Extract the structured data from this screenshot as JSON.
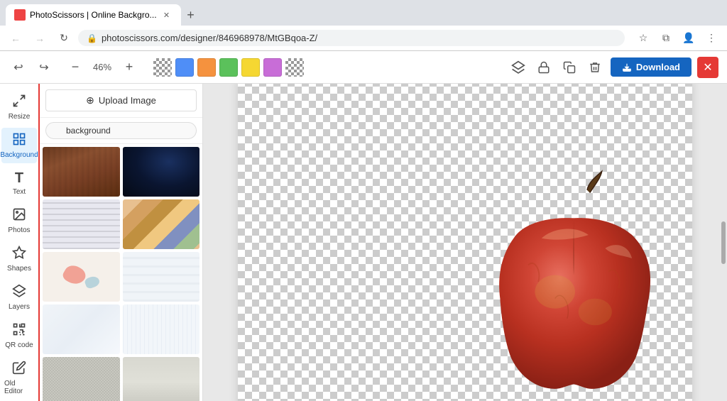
{
  "browser": {
    "tab_title": "PhotoScissors | Online Backgro...",
    "tab_favicon": "🖼",
    "url": "photoscissors.com/designer/846968978/MtGBqoa-Z/",
    "url_protocol": "🔒",
    "new_tab_label": "+",
    "nav": {
      "back": "←",
      "forward": "→",
      "reload": "↻",
      "secure": "⊙"
    }
  },
  "toolbar": {
    "undo": "↩",
    "redo": "↪",
    "zoom_out": "−",
    "zoom_level": "46%",
    "zoom_in": "+",
    "download_label": "Download",
    "close_label": "✕",
    "colors": [
      "#4f8ef7",
      "#f5923e",
      "#5bc15b",
      "#f5d732",
      "#c86dd7"
    ],
    "icons": {
      "layers": "⊞",
      "lock": "🔒",
      "duplicate": "⧉",
      "trash": "🗑"
    }
  },
  "sidebar": {
    "items": [
      {
        "id": "resize",
        "label": "Resize",
        "icon": "⤢"
      },
      {
        "id": "background",
        "label": "Background",
        "icon": "⊞",
        "active": true
      },
      {
        "id": "text",
        "label": "Text",
        "icon": "T"
      },
      {
        "id": "photos",
        "label": "Photos",
        "icon": "🖼"
      },
      {
        "id": "shapes",
        "label": "Shapes",
        "icon": "◈"
      },
      {
        "id": "layers",
        "label": "Layers",
        "icon": "⊛"
      },
      {
        "id": "qrcode",
        "label": "QR code",
        "icon": "⊞"
      },
      {
        "id": "old-editor",
        "label": "Old Editor",
        "icon": "✎"
      }
    ]
  },
  "panel": {
    "upload_label": "Upload Image",
    "search_placeholder": "background",
    "images": [
      {
        "id": 1,
        "color": "#7a4a2a",
        "type": "wood"
      },
      {
        "id": 2,
        "color": "#1a2a4a",
        "type": "dark-space"
      },
      {
        "id": 3,
        "color": "#c8c8d0",
        "type": "light-stripes"
      },
      {
        "id": 4,
        "color": "#d4956a",
        "type": "colorful-stripes"
      },
      {
        "id": 5,
        "color": "#e8d4c0",
        "type": "paint-splatter"
      },
      {
        "id": 6,
        "color": "#e8eff5",
        "type": "white-wood"
      },
      {
        "id": 7,
        "color": "#f0f4f8",
        "type": "light-abstract"
      },
      {
        "id": 8,
        "color": "#e8eef5",
        "type": "white-fabric"
      },
      {
        "id": 9,
        "color": "#c8c8c0",
        "type": "gray-texture"
      },
      {
        "id": 10,
        "color": "#d0d0d0",
        "type": "light-gray"
      }
    ]
  },
  "canvas": {
    "zoom": "46%"
  }
}
